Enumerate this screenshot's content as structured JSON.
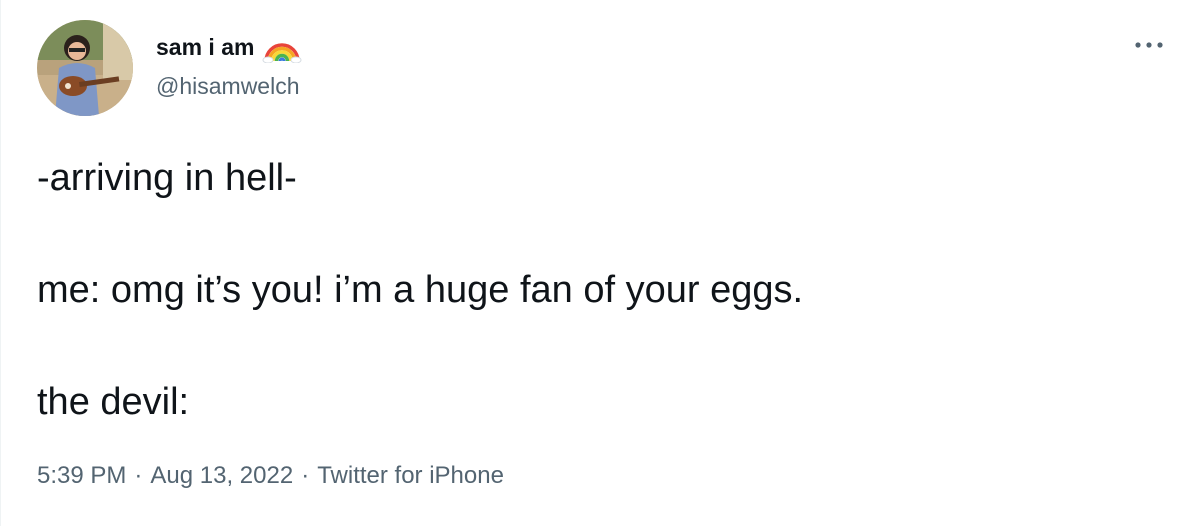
{
  "author": {
    "display_name": "sam i am",
    "handle": "@hisamwelch",
    "name_emoji": "rainbow-icon",
    "avatar": "avatar"
  },
  "tweet": {
    "lines": [
      "-arriving in hell-",
      "me: omg it’s you! i’m a huge fan of your eggs.",
      "the devil:"
    ]
  },
  "meta": {
    "time": "5:39 PM",
    "date": "Aug 13, 2022",
    "source": "Twitter for iPhone",
    "separator": "·"
  },
  "icons": {
    "more": "more-dots-icon"
  },
  "colors": {
    "text_primary": "#0f1419",
    "text_secondary": "#536471",
    "background": "#ffffff"
  }
}
